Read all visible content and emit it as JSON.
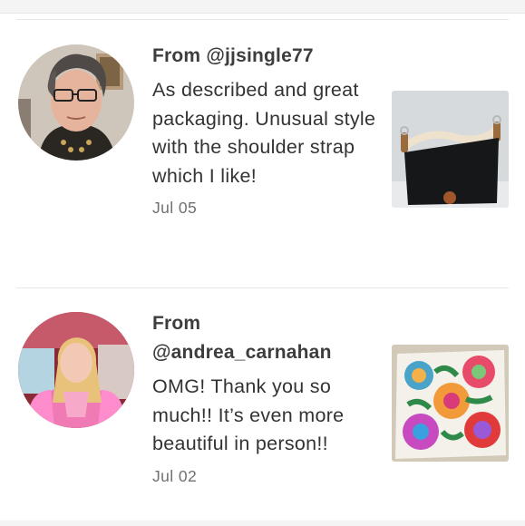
{
  "reviews": [
    {
      "from": "From @jjsingle77",
      "comment": "As described and great packaging. Unusual style with the shoulder strap which I like!",
      "date": "Jul 05",
      "avatar_icon": "user-avatar-photo",
      "product_icon": "black-shoulder-bag-photo"
    },
    {
      "from": "From @andrea_carnahan",
      "comment": "OMG! Thank you so much!! It’s even more beautiful in person!!",
      "date": "Jul 02",
      "avatar_icon": "user-avatar-photo",
      "product_icon": "floral-scarf-photo"
    }
  ],
  "colors": {
    "divider": "#e8e8e8",
    "text_primary": "#333333",
    "text_secondary": "#707070"
  }
}
